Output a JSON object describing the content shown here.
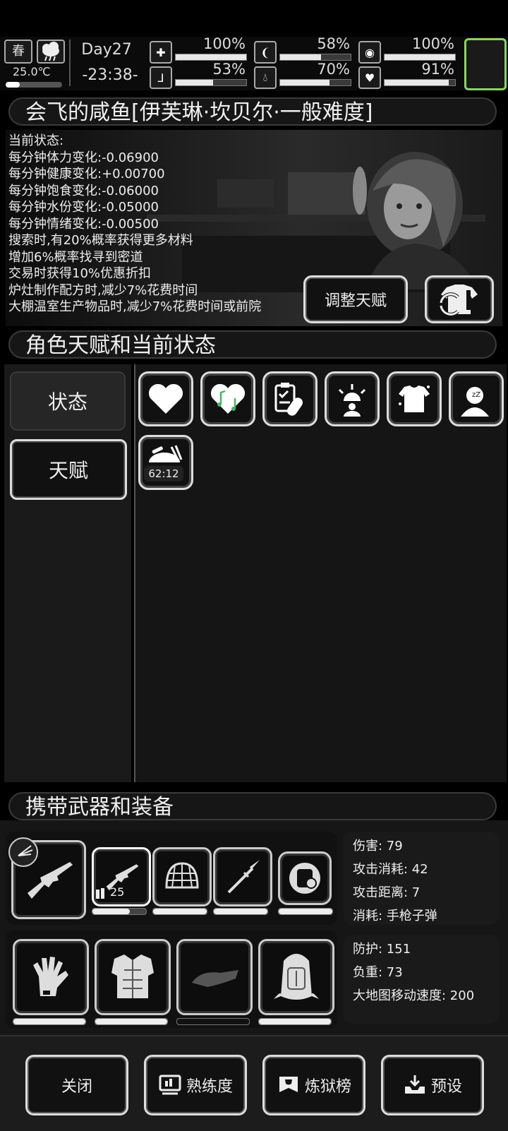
{
  "topbar": {
    "season": "春",
    "temperature": "25.0℃",
    "day": "Day27",
    "clock": "-23:38-",
    "stats": [
      {
        "icon": "medkit-icon",
        "value": "100%",
        "level": 1.0
      },
      {
        "icon": "stomach-icon",
        "value": "58%",
        "level": 0.58
      },
      {
        "icon": "bladder-icon",
        "value": "100%",
        "level": 1.0
      },
      {
        "icon": "boot-icon",
        "value": "53%",
        "level": 0.53
      },
      {
        "icon": "water-drop-icon",
        "value": "70%",
        "level": 0.7
      },
      {
        "icon": "heart-icon",
        "value": "91%",
        "level": 0.91
      }
    ]
  },
  "character": {
    "title": "会飞的咸鱼[伊芙琳·坎贝尔·一般难度]",
    "status_heading": "当前状态:",
    "status_lines": [
      "每分钟体力变化:-0.06900",
      "每分钟健康变化:+0.00700",
      "每分钟饱食变化:-0.06000",
      "每分钟水份变化:-0.05000",
      "每分钟情绪变化:-0.00500",
      "搜索时,有20%概率获得更多材料",
      "增加6%概率找寻到密道",
      "交易时获得10%优惠折扣",
      "炉灶制作配方时,减少7%花费时间",
      "大棚温室生产物品时,减少7%花费时间或前院"
    ],
    "adjust_talent_label": "调整天赋"
  },
  "talents": {
    "title": "角色天赋和当前状态",
    "tabs": [
      "状态",
      "天赋"
    ],
    "status_icons": [
      "heart-icon",
      "music-heart-icon",
      "medicine-clipboard-icon",
      "alarm-person-icon",
      "shirt-icon",
      "sleeping-person-icon"
    ],
    "timer_icon": "food-bowl-icon",
    "timer_text": "62:12"
  },
  "equipment": {
    "title": "携带武器和装备",
    "weapon_ammo": "25",
    "weapon_info": [
      "伤害: 79",
      "攻击消耗: 42",
      "攻击距离: 7",
      "消耗: 手枪子弹"
    ],
    "armor_info": [
      "防护: 151",
      "负重: 73",
      "大地图移动速度: 200"
    ]
  },
  "bottom": {
    "close": "关闭",
    "proficiency": "熟练度",
    "ranking": "炼狱榜",
    "preset": "预设"
  }
}
